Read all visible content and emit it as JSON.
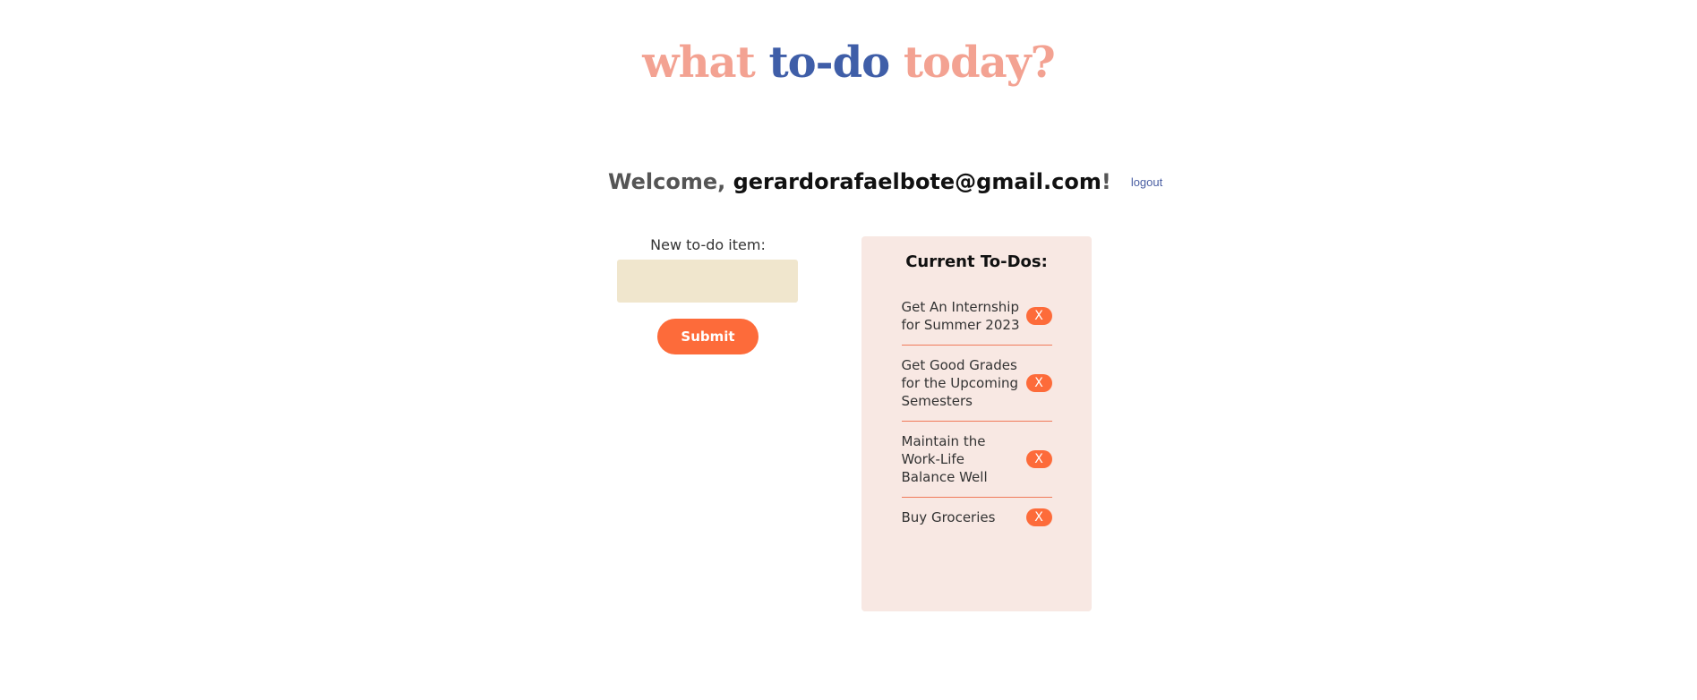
{
  "header": {
    "title_words": [
      "what",
      "to-do",
      "today?"
    ]
  },
  "welcome": {
    "prefix": "Welcome, ",
    "email": "gerardorafaelbote@gmail.com",
    "suffix": "!",
    "logout_label": "logout"
  },
  "new_item": {
    "label": "New to-do item:",
    "value": "",
    "placeholder": "",
    "submit_label": "Submit"
  },
  "todos": {
    "title": "Current To-Dos:",
    "delete_label": "X",
    "items": [
      {
        "text": "Get An Internship for Summer 2023"
      },
      {
        "text": "Get Good Grades for the Upcoming Semesters"
      },
      {
        "text": "Maintain the Work-Life Balance Well"
      },
      {
        "text": "Buy Groceries"
      }
    ]
  },
  "colors": {
    "title_accent": "#f3a292",
    "title_primary": "#3f5ea8",
    "button": "#fd6b3a",
    "input_bg": "#f0e6cd",
    "panel_bg": "#f8e8e3",
    "link": "#4a5fa3"
  }
}
